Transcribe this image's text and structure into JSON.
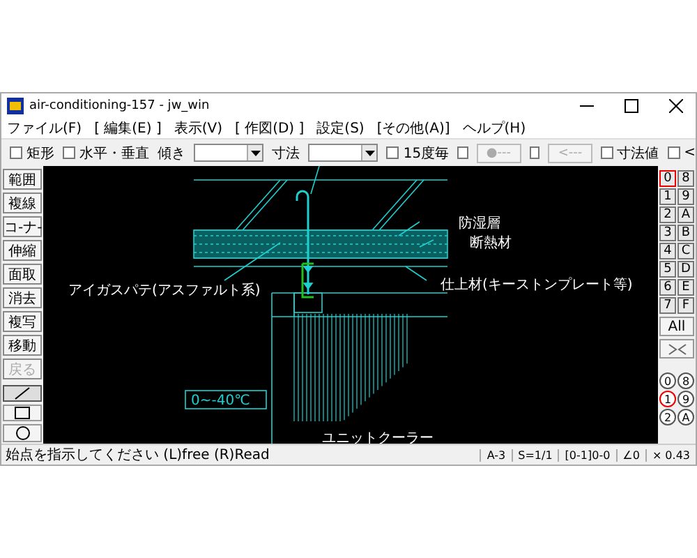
{
  "window": {
    "title": "air-conditioning-157 - jw_win"
  },
  "menu": [
    "ファイル(F)",
    "[ 編集(E) ]",
    "表示(V)",
    "[ 作図(D) ]",
    "設定(S)",
    "[その他(A)]",
    "ヘルプ(H)"
  ],
  "toolbar": [
    {
      "kind": "checkbox",
      "label": "矩形",
      "checked": false
    },
    {
      "kind": "checkbox",
      "label": "水平・垂直",
      "checked": false
    },
    {
      "kind": "dropdown",
      "label": "傾き"
    },
    {
      "kind": "dropdown",
      "label": "寸法"
    },
    {
      "kind": "checkbox",
      "label": "15度毎",
      "checked": false
    },
    {
      "kind": "checkbutton",
      "label": "●---",
      "checked": false
    },
    {
      "kind": "checkbutton",
      "label": "<---",
      "checked": false
    },
    {
      "kind": "checkbox",
      "label": "寸法値",
      "checked": false
    },
    {
      "kind": "checkbox",
      "label": "<",
      "checked": false
    }
  ],
  "tools": [
    {
      "label": "範囲",
      "disabled": false
    },
    {
      "label": "複線",
      "disabled": false
    },
    {
      "label": "コ-ナ-",
      "disabled": false
    },
    {
      "label": "伸縮",
      "disabled": false
    },
    {
      "label": "面取",
      "disabled": false
    },
    {
      "label": "消去",
      "disabled": false
    },
    {
      "label": "複写",
      "disabled": false
    },
    {
      "label": "移動",
      "disabled": false
    },
    {
      "label": "戻る",
      "disabled": true
    }
  ],
  "draw_tools": [
    {
      "kind": "line",
      "selected": true
    },
    {
      "kind": "rect",
      "selected": false
    },
    {
      "kind": "circle",
      "selected": false
    }
  ],
  "layers": [
    {
      "label": "0",
      "selected": true
    },
    {
      "label": "8",
      "selected": false
    },
    {
      "label": "1",
      "selected": false
    },
    {
      "label": "9",
      "selected": false
    },
    {
      "label": "2",
      "selected": false
    },
    {
      "label": "A",
      "selected": false
    },
    {
      "label": "3",
      "selected": false
    },
    {
      "label": "B",
      "selected": false
    },
    {
      "label": "4",
      "selected": false
    },
    {
      "label": "C",
      "selected": false
    },
    {
      "label": "5",
      "selected": false
    },
    {
      "label": "D",
      "selected": false
    },
    {
      "label": "6",
      "selected": false
    },
    {
      "label": "E",
      "selected": false
    },
    {
      "label": "7",
      "selected": false
    },
    {
      "label": "F",
      "selected": false
    }
  ],
  "layer_all": "All",
  "groups": [
    {
      "label": "0",
      "selected": false
    },
    {
      "label": "8",
      "selected": false
    },
    {
      "label": "1",
      "selected": true
    },
    {
      "label": "9",
      "selected": false
    },
    {
      "label": "2",
      "selected": false
    },
    {
      "label": "A",
      "selected": false
    }
  ],
  "drawing_labels": [
    "防湿層",
    "断熱材",
    "アイガスパテ(アスファルト系)",
    "仕上材(キーストンプレート等)",
    "0~-40℃",
    "ユニットクーラー"
  ],
  "status": {
    "message": "始点を指示してください (L)free (R)Read",
    "fields": [
      "A-3",
      "S=1/1",
      "[0-1]0-0",
      "∠0",
      "× 0.43"
    ]
  }
}
